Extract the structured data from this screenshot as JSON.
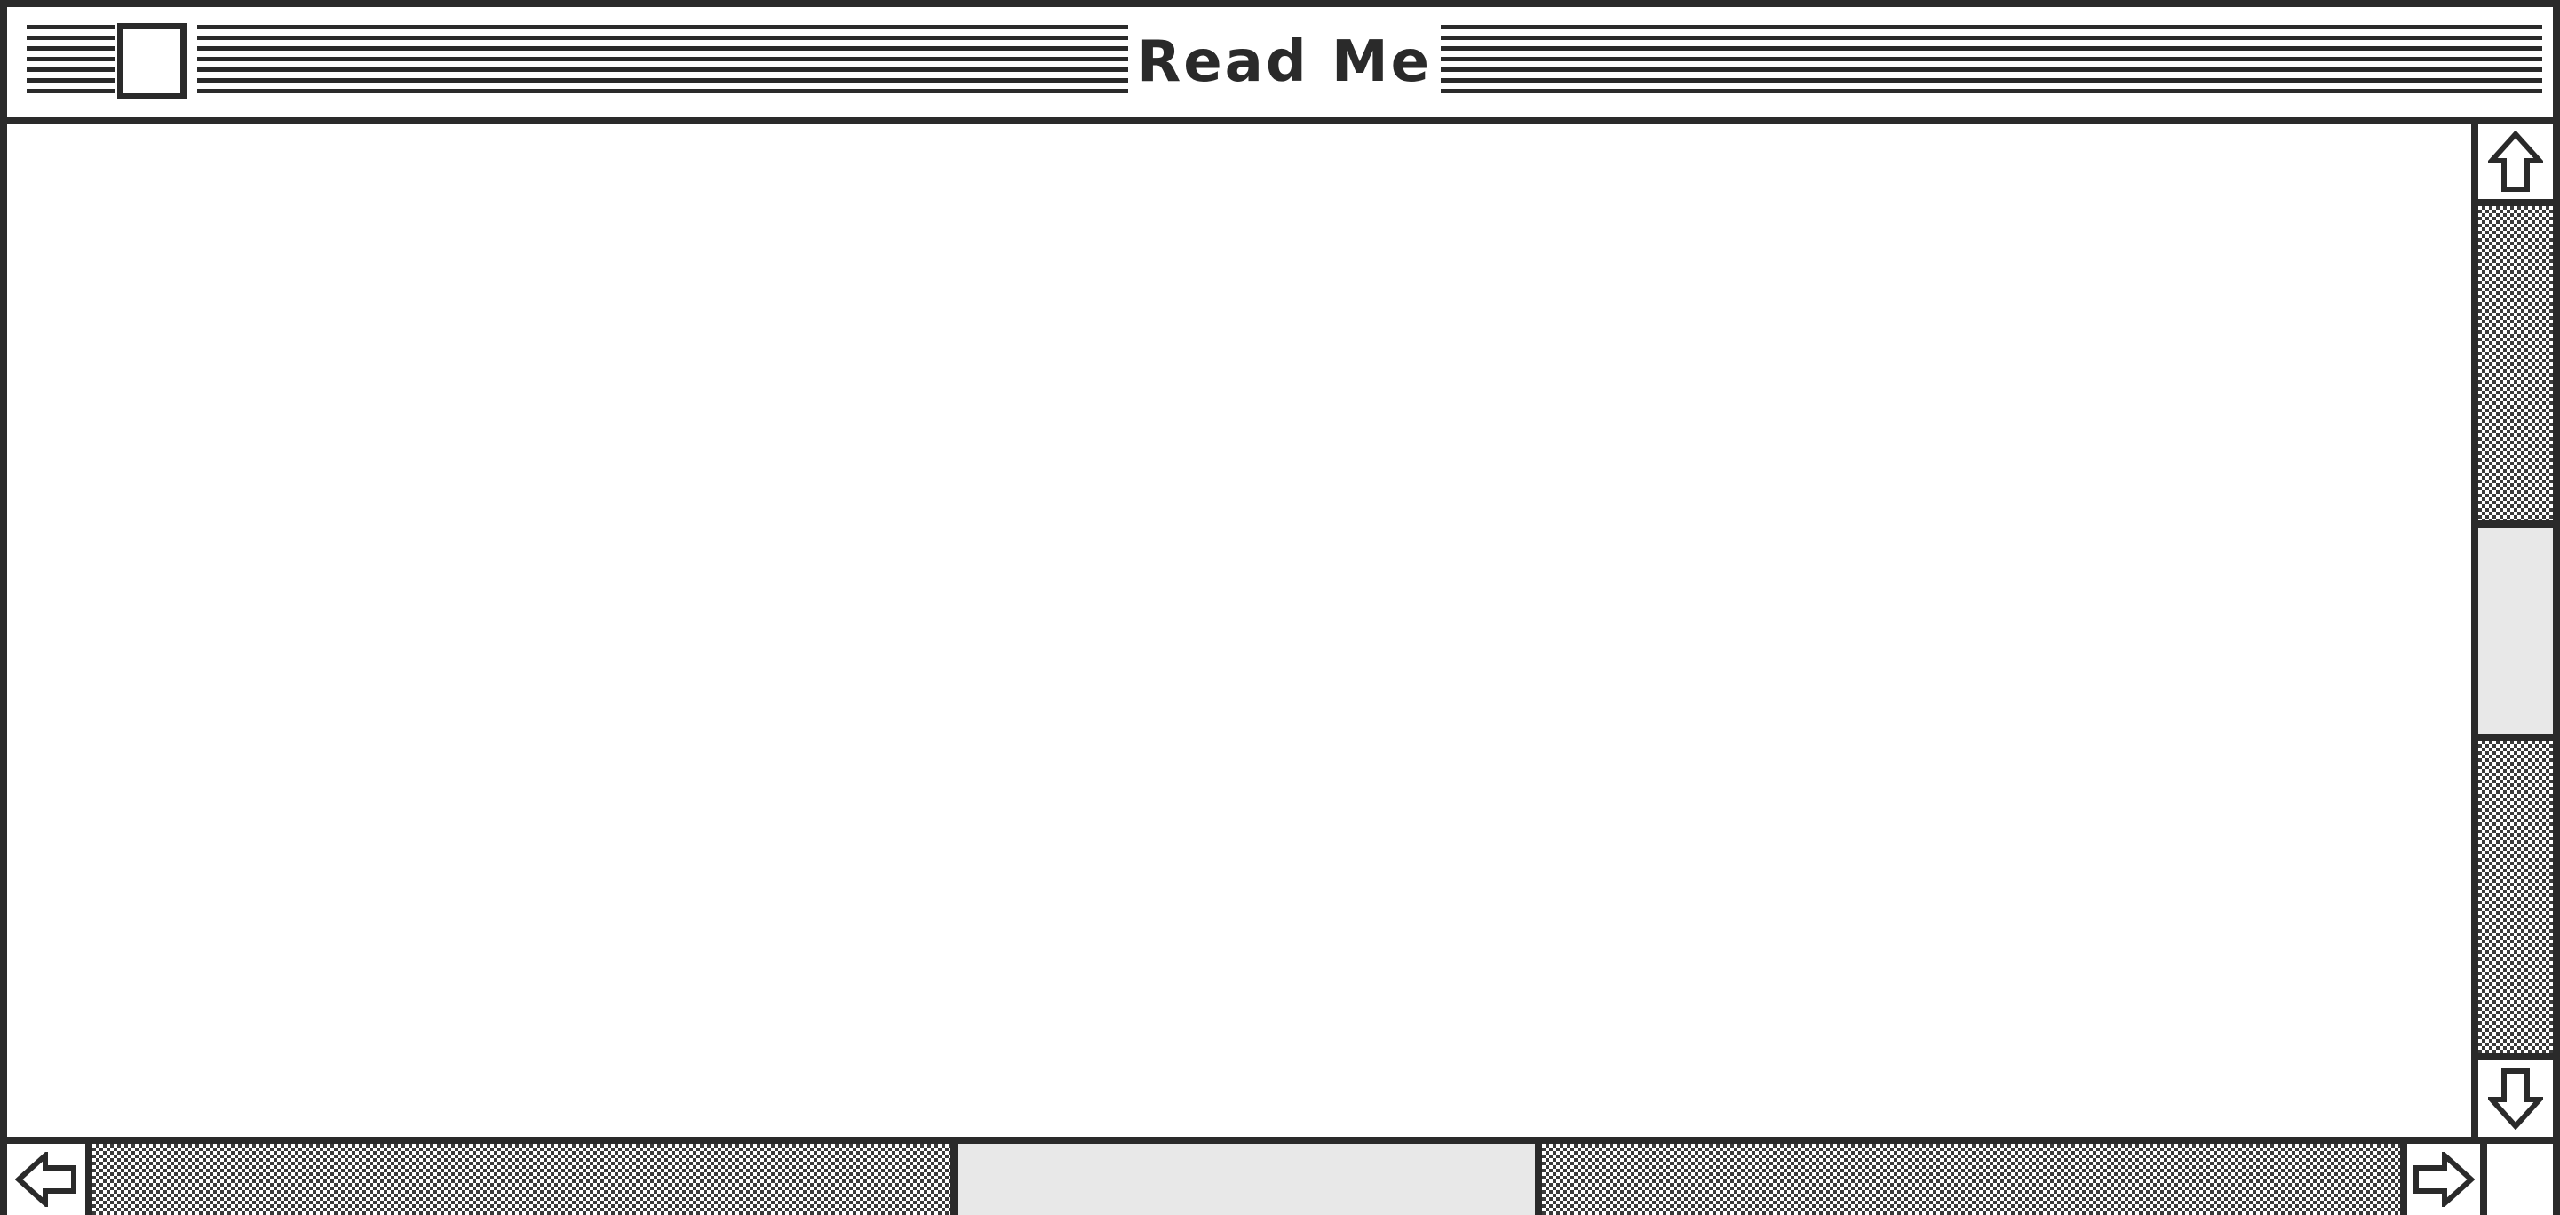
{
  "window": {
    "title": "Read Me"
  },
  "icons": {
    "close_box": "close-box-icon",
    "scroll_up": "arrow-up-icon",
    "scroll_down": "arrow-down-icon",
    "scroll_left": "arrow-left-icon",
    "scroll_right": "arrow-right-icon"
  },
  "scroll": {
    "vertical_position": 0.5,
    "horizontal_position": 0.5
  },
  "colors": {
    "frame": "#2a2a2a",
    "background": "#ffffff",
    "thumb": "#e8e8e8"
  }
}
